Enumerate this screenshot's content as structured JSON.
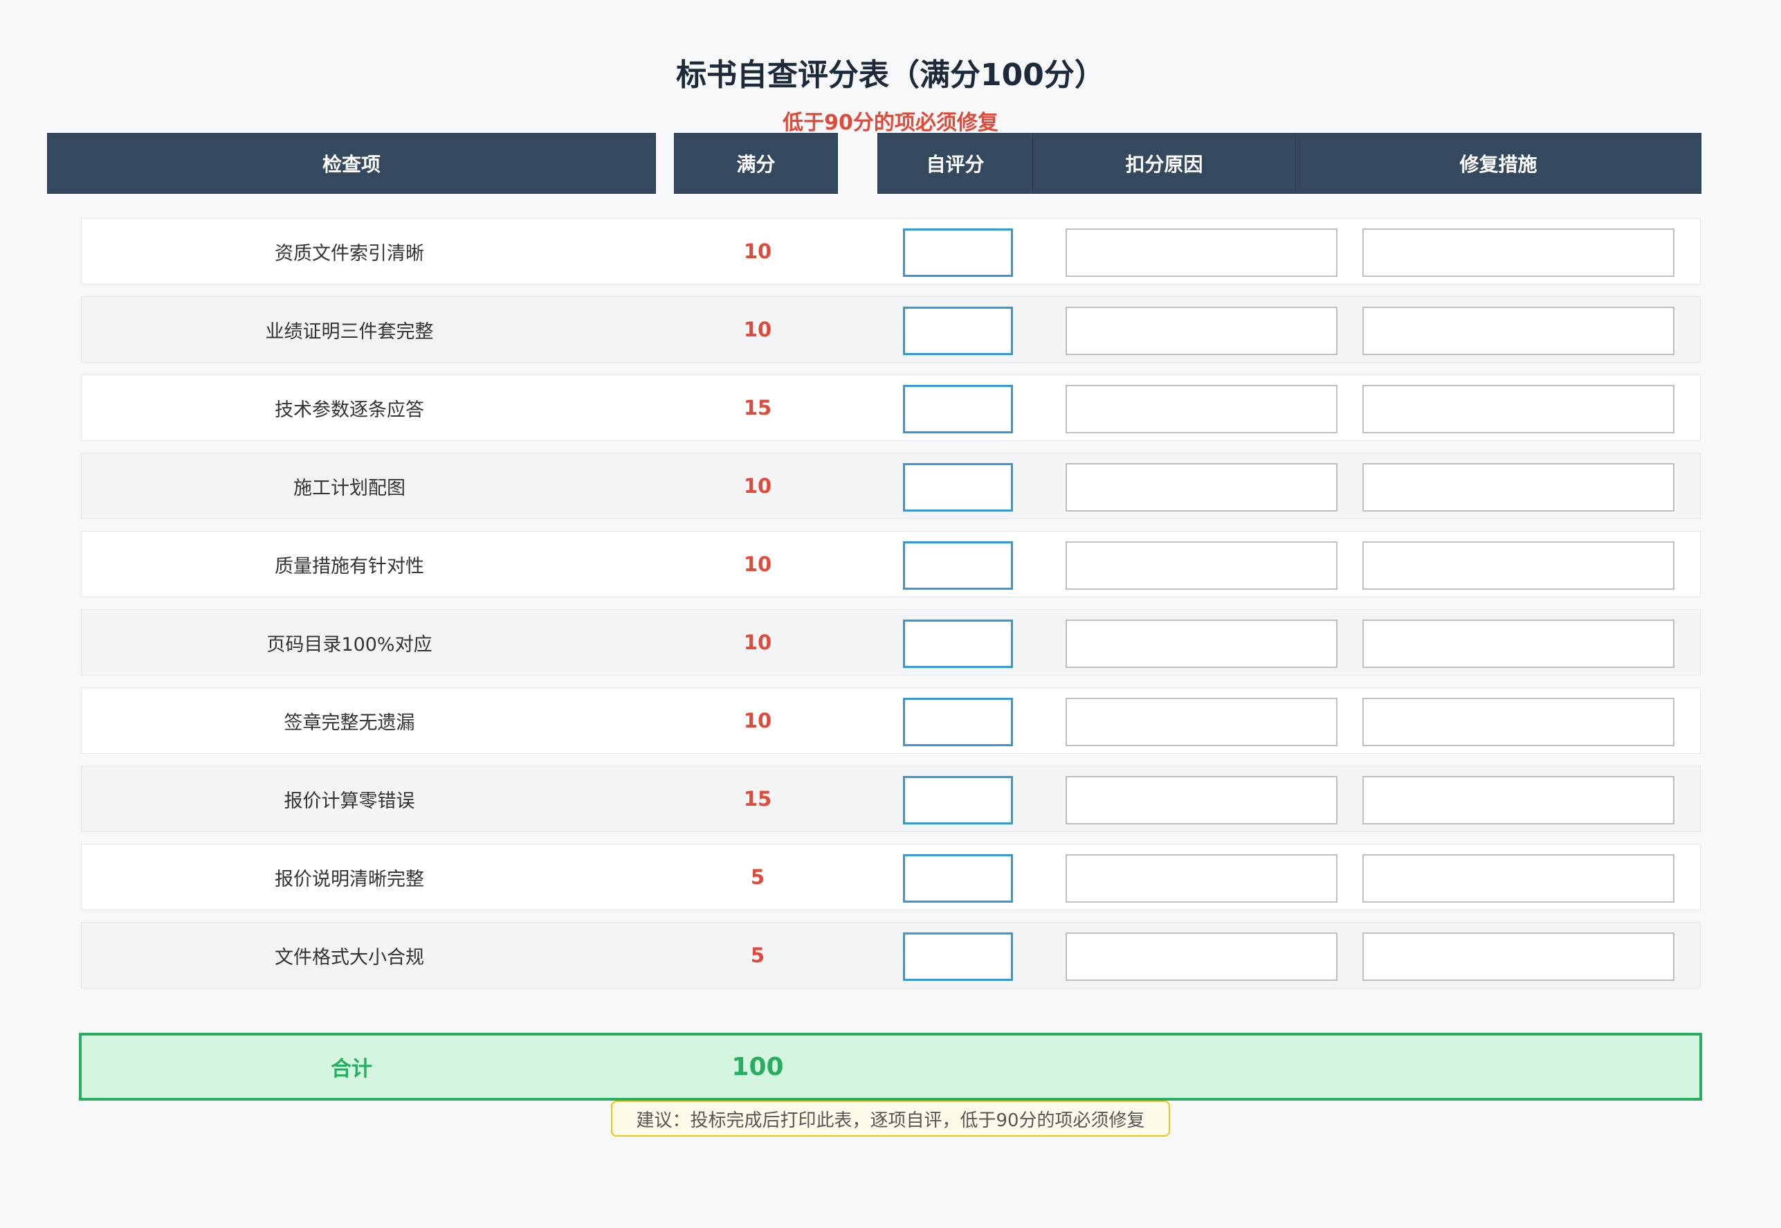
{
  "title": "标书自查评分表（满分100分）",
  "subtitle": "低于90分的项必须修复",
  "headers": {
    "item": "检查项",
    "full": "满分",
    "score": "自评分",
    "reason": "扣分原因",
    "fix": "修复措施"
  },
  "rows": [
    {
      "item": "资质文件索引清晰",
      "full": "10",
      "score": "",
      "reason": "",
      "fix": ""
    },
    {
      "item": "业绩证明三件套完整",
      "full": "10",
      "score": "",
      "reason": "",
      "fix": ""
    },
    {
      "item": "技术参数逐条应答",
      "full": "15",
      "score": "",
      "reason": "",
      "fix": ""
    },
    {
      "item": "施工计划配图",
      "full": "10",
      "score": "",
      "reason": "",
      "fix": ""
    },
    {
      "item": "质量措施有针对性",
      "full": "10",
      "score": "",
      "reason": "",
      "fix": ""
    },
    {
      "item": "页码目录100%对应",
      "full": "10",
      "score": "",
      "reason": "",
      "fix": ""
    },
    {
      "item": "签章完整无遗漏",
      "full": "10",
      "score": "",
      "reason": "",
      "fix": ""
    },
    {
      "item": "报价计算零错误",
      "full": "15",
      "score": "",
      "reason": "",
      "fix": ""
    },
    {
      "item": "报价说明清晰完整",
      "full": "5",
      "score": "",
      "reason": "",
      "fix": ""
    },
    {
      "item": "文件格式大小合规",
      "full": "5",
      "score": "",
      "reason": "",
      "fix": ""
    }
  ],
  "total": {
    "label": "合计",
    "value": "100"
  },
  "note": "建议：投标完成后打印此表，逐项自评，低于90分的项必须修复",
  "colors": {
    "header_bg": "#34495e",
    "full_score": "#e04a3a",
    "score_border": "#3498db",
    "total_border": "#27ae60",
    "total_bg": "#d4f5e0",
    "note_border": "#f1c40f"
  }
}
